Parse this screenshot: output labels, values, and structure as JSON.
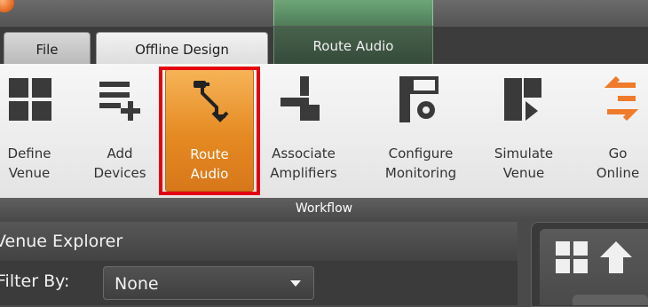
{
  "tabs": [
    {
      "label": "File",
      "active": false
    },
    {
      "label": "Offline Design",
      "active": true
    },
    {
      "label": "Route Audio",
      "active": false
    }
  ],
  "ribbon": {
    "buttons": [
      {
        "line1": "Define",
        "line2": "Venue",
        "icon": "define-venue-icon"
      },
      {
        "line1": "Add",
        "line2": "Devices",
        "icon": "add-devices-icon"
      },
      {
        "line1": "Route",
        "line2": "Audio",
        "icon": "route-audio-icon",
        "active": true
      },
      {
        "line1": "Associate",
        "line2": "Amplifiers",
        "icon": "associate-amplifiers-icon"
      },
      {
        "line1": "Configure",
        "line2": "Monitoring",
        "icon": "configure-monitoring-icon"
      },
      {
        "line1": "Simulate",
        "line2": "Venue",
        "icon": "simulate-venue-icon"
      },
      {
        "line1": "Go",
        "line2": "Online",
        "icon": "go-online-icon"
      }
    ],
    "group_label": "Workflow"
  },
  "explorer": {
    "title": "Venue Explorer",
    "filter_label": "Filter By:",
    "filter_value": "None"
  },
  "colors": {
    "accent_orange": "#e58a22",
    "highlight_red": "#e4000f",
    "tab_green": "#4f7d58"
  }
}
